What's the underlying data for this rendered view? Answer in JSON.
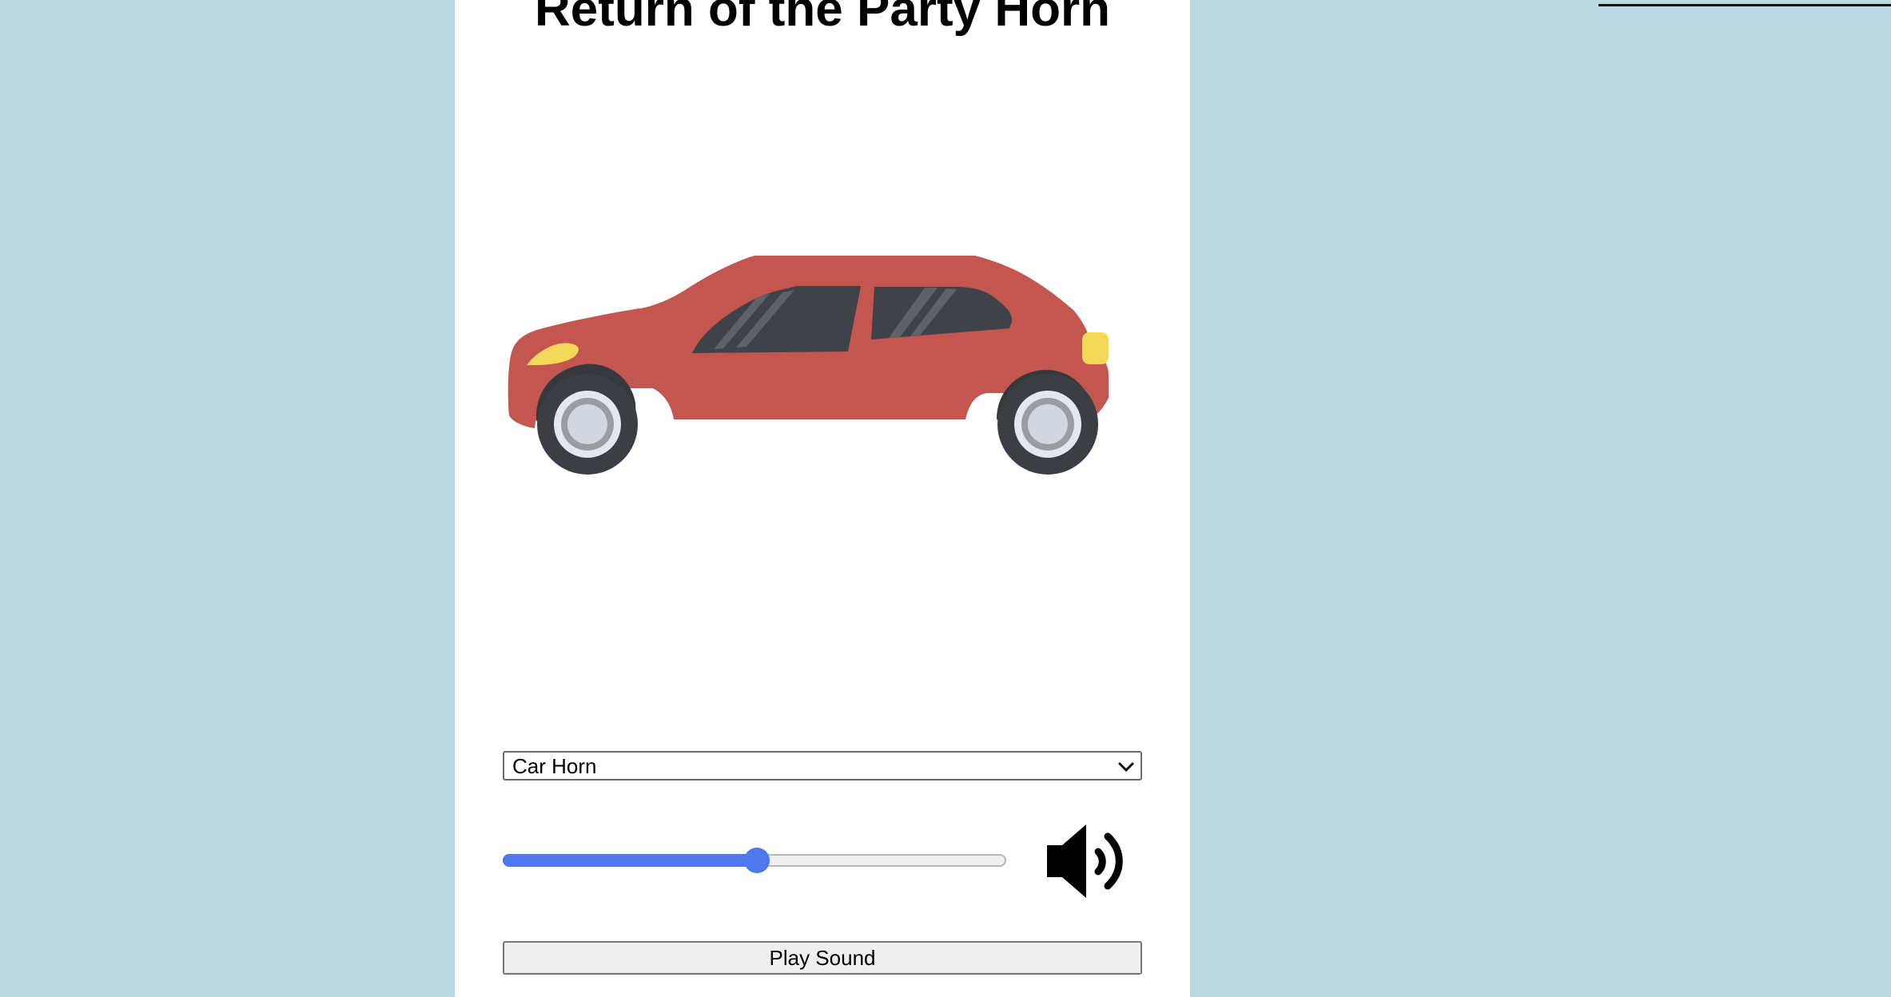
{
  "page": {
    "title": "Return of the Party Horn"
  },
  "horn_image": {
    "icon": "car-icon",
    "body_color": "#c45650",
    "window_color": "#3f4248",
    "light_color": "#f3d85a"
  },
  "sound_select": {
    "selected": "Car Horn"
  },
  "volume": {
    "value_percent": 50,
    "icon": "volume-level-3-icon"
  },
  "play_button": {
    "label": "Play Sound"
  },
  "colors": {
    "background": "#bcd8e3",
    "panel": "#ffffff",
    "accent": "#4f78ee"
  }
}
